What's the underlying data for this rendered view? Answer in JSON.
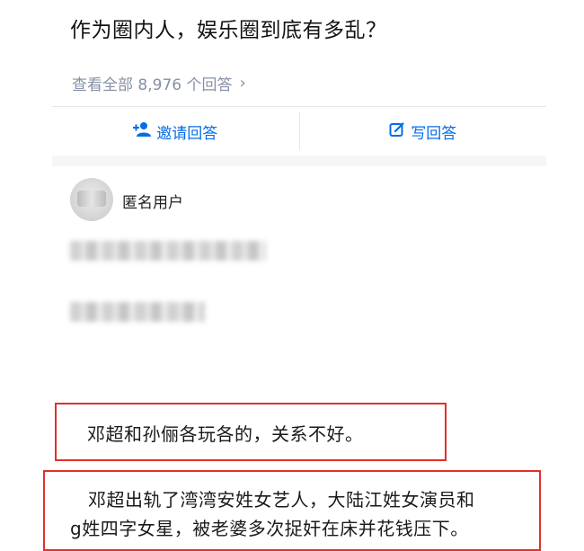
{
  "question": {
    "title": "作为圈内人，娱乐圈到底有多乱？"
  },
  "answers_link": {
    "label": "查看全部 8,976 个回答",
    "chevron": "›"
  },
  "actions": {
    "invite": {
      "label": "邀请回答",
      "icon": "add-person-icon"
    },
    "write": {
      "label": "写回答",
      "icon": "edit-icon"
    }
  },
  "answer": {
    "author": "匿名用户",
    "highlight1": "邓超和孙俪各玩各的，关系不好。",
    "highlight2_line1": "邓超出轨了湾湾安姓女艺人，大陆江姓女演员和",
    "highlight2_line2": "g姓四字女星，被老婆多次捉奸在床并花钱压下。"
  },
  "colors": {
    "accent": "#056de8",
    "highlight_border": "#e0302a",
    "muted": "#8590a6"
  }
}
